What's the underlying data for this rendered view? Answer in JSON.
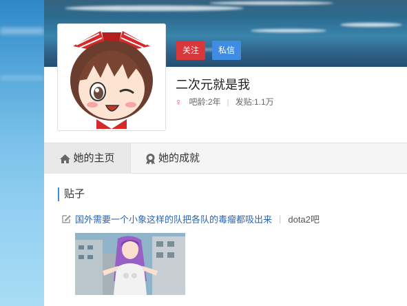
{
  "profile": {
    "username": "二次元就是我",
    "gender_icon": "female-icon",
    "age_label": "吧龄:2年",
    "posts_label": "发贴:1.1万",
    "follow_button": "关注",
    "message_button": "私信"
  },
  "tabs": [
    {
      "label": "她的主页",
      "icon": "home-icon",
      "active": true
    },
    {
      "label": "她的成就",
      "icon": "badge-icon",
      "active": false
    }
  ],
  "posts_section": {
    "title": "贴子",
    "items": [
      {
        "title": "国外需要一个小象这样的队把各队的毒瘤都吸出来",
        "forum": "dota2吧",
        "icon": "edit-icon"
      }
    ]
  },
  "colors": {
    "follow": "#d8383b",
    "message": "#3f8de3",
    "link": "#2d64b3",
    "female": "#e1577b"
  }
}
